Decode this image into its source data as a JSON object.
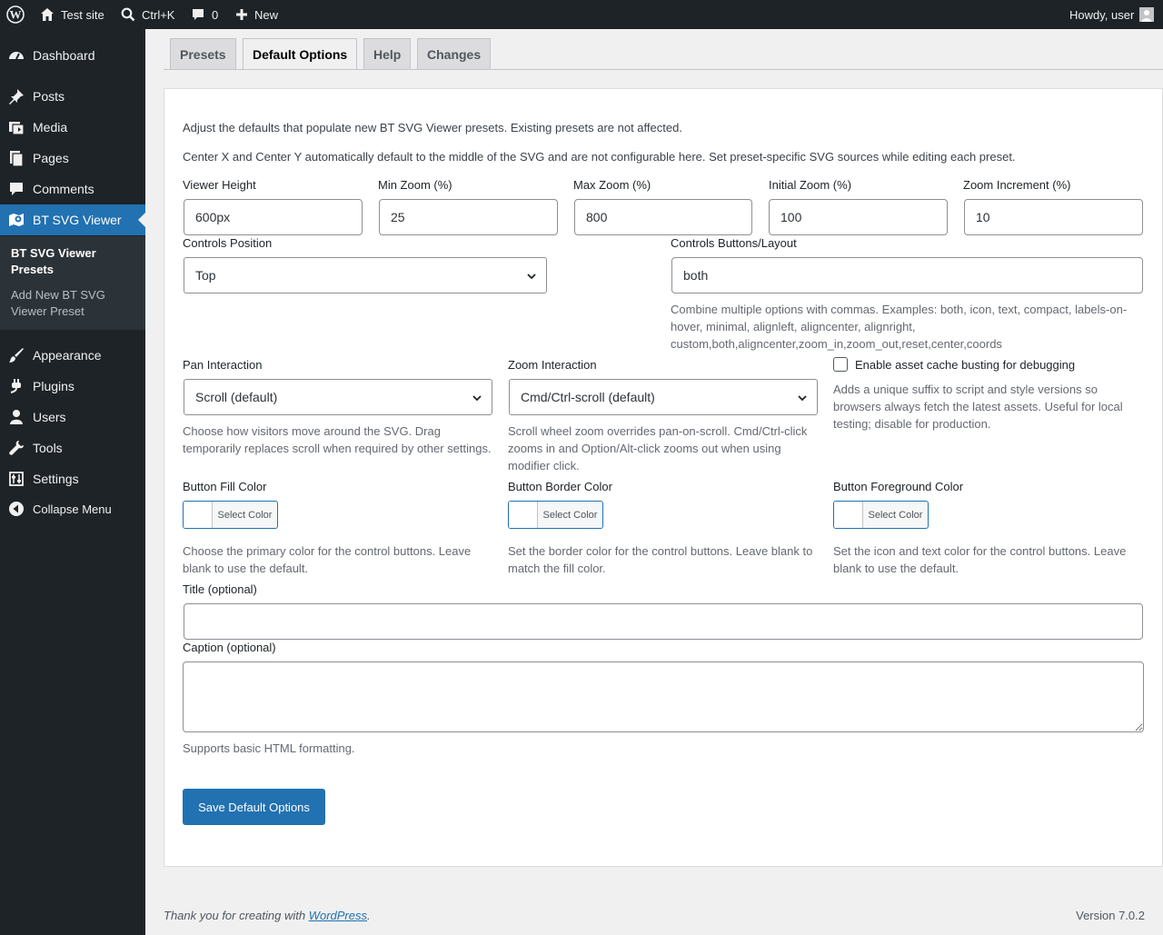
{
  "adminbar": {
    "site_name": "Test site",
    "search_shortcut": "Ctrl+K",
    "comments_count": "0",
    "new_label": "New",
    "greeting": "Howdy, user"
  },
  "sidebar": {
    "items": [
      {
        "label": "Dashboard",
        "icon": "dashboard-icon"
      },
      {
        "label": "Posts",
        "icon": "pushpin-icon"
      },
      {
        "label": "Media",
        "icon": "media-icon"
      },
      {
        "label": "Pages",
        "icon": "pages-icon"
      },
      {
        "label": "Comments",
        "icon": "comment-icon"
      },
      {
        "label": "BT SVG Viewer",
        "icon": "map-icon"
      },
      {
        "label": "Appearance",
        "icon": "brush-icon"
      },
      {
        "label": "Plugins",
        "icon": "plug-icon"
      },
      {
        "label": "Users",
        "icon": "user-icon"
      },
      {
        "label": "Tools",
        "icon": "wrench-icon"
      },
      {
        "label": "Settings",
        "icon": "sliders-icon"
      },
      {
        "label": "Collapse Menu",
        "icon": "collapse-icon"
      }
    ],
    "submenu": {
      "presets": "BT SVG Viewer Presets",
      "add_new": "Add New BT SVG Viewer Preset"
    }
  },
  "tabs": [
    "Presets",
    "Default Options",
    "Help",
    "Changes"
  ],
  "intro": {
    "line1": "Adjust the defaults that populate new BT SVG Viewer presets. Existing presets are not affected.",
    "line2": "Center X and Center Y automatically default to the middle of the SVG and are not configurable here. Set preset-specific SVG sources while editing each preset."
  },
  "fields": {
    "viewer_height": {
      "label": "Viewer Height",
      "value": "600px"
    },
    "min_zoom": {
      "label": "Min Zoom (%)",
      "value": "25"
    },
    "max_zoom": {
      "label": "Max Zoom (%)",
      "value": "800"
    },
    "initial_zoom": {
      "label": "Initial Zoom (%)",
      "value": "100"
    },
    "zoom_increment": {
      "label": "Zoom Increment (%)",
      "value": "10"
    },
    "controls_position": {
      "label": "Controls Position",
      "value": "Top"
    },
    "controls_buttons": {
      "label": "Controls Buttons/Layout",
      "value": "both",
      "help": "Combine multiple options with commas. Examples: both, icon, text, compact, labels-on-hover, minimal, alignleft, aligncenter, alignright, custom,both,aligncenter,zoom_in,zoom_out,reset,center,coords"
    },
    "pan_interaction": {
      "label": "Pan Interaction",
      "value": "Scroll (default)",
      "help": "Choose how visitors move around the SVG. Drag temporarily replaces scroll when required by other settings."
    },
    "zoom_interaction": {
      "label": "Zoom Interaction",
      "value": "Cmd/Ctrl-scroll (default)",
      "help": "Scroll wheel zoom overrides pan-on-scroll. Cmd/Ctrl-click zooms in and Option/Alt-click zooms out when using modifier click."
    },
    "cache_busting": {
      "label": "Enable asset cache busting for debugging",
      "checked": false,
      "help": "Adds a unique suffix to script and style versions so browsers always fetch the latest assets. Useful for local testing; disable for production."
    },
    "button_fill": {
      "label": "Button Fill Color",
      "button": "Select Color",
      "help": "Choose the primary color for the control buttons. Leave blank to use the default."
    },
    "button_border": {
      "label": "Button Border Color",
      "button": "Select Color",
      "help": "Set the border color for the control buttons. Leave blank to match the fill color."
    },
    "button_foreground": {
      "label": "Button Foreground Color",
      "button": "Select Color",
      "help": "Set the icon and text color for the control buttons. Leave blank to use the default."
    },
    "title": {
      "label": "Title (optional)",
      "value": ""
    },
    "caption": {
      "label": "Caption (optional)",
      "value": "",
      "help": "Supports basic HTML formatting."
    }
  },
  "save_label": "Save Default Options",
  "footer": {
    "thanks_prefix": "Thank you for creating with ",
    "thanks_link": "WordPress",
    "thanks_suffix": ".",
    "version": "Version 7.0.2"
  },
  "colors": {
    "adminbar_bg": "#1d2327",
    "accent": "#2271b1",
    "page_bg": "#f0f0f1"
  }
}
